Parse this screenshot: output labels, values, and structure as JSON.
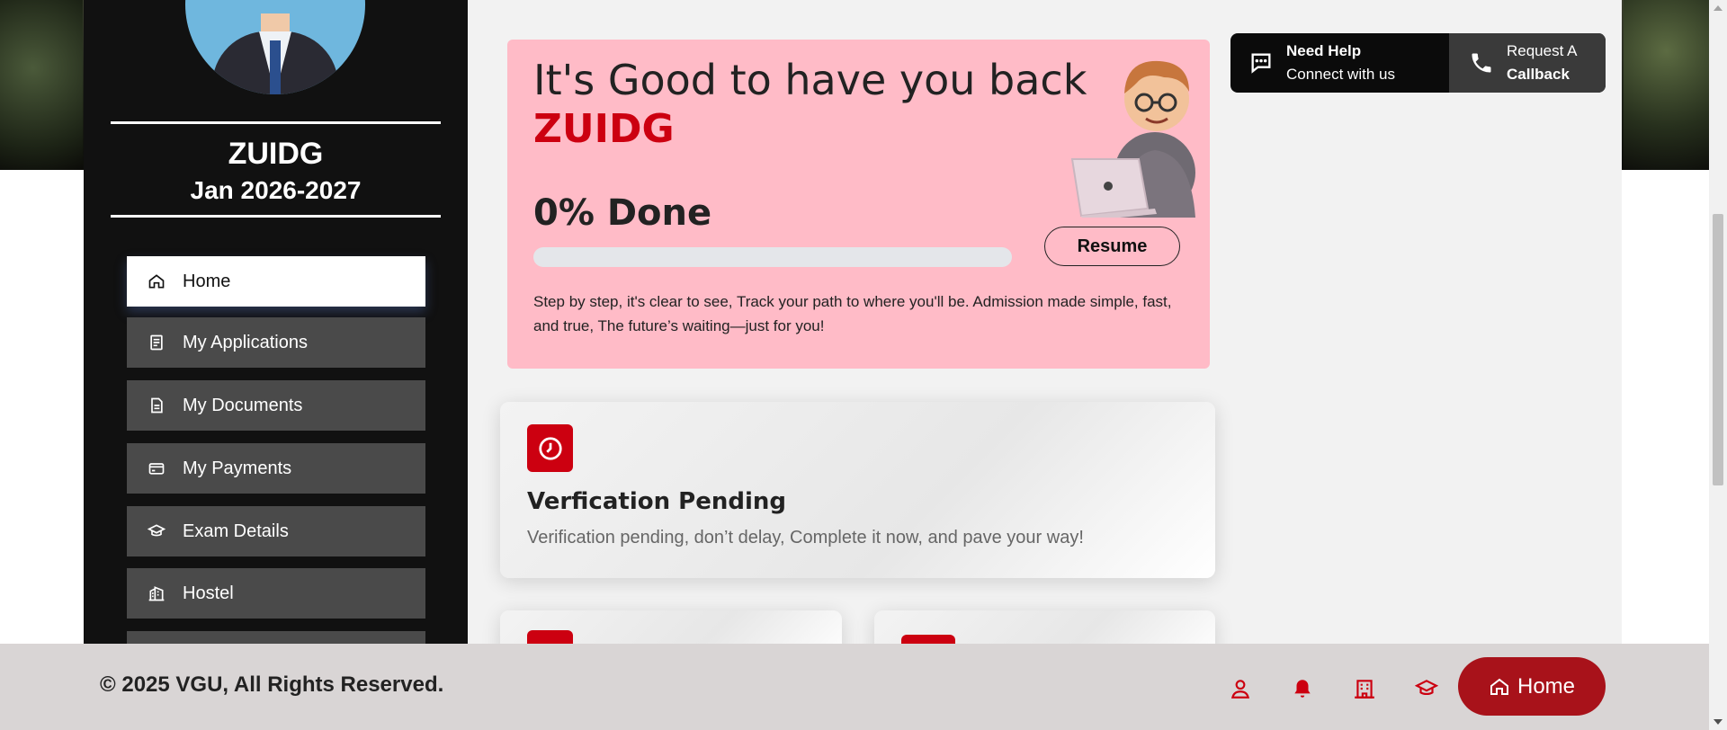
{
  "user": {
    "name": "ZUIDG",
    "session": "Jan 2026-2027"
  },
  "sidebar": {
    "items": [
      {
        "label": "Home",
        "icon": "home-icon"
      },
      {
        "label": "My Applications",
        "icon": "application-icon"
      },
      {
        "label": "My Documents",
        "icon": "document-icon"
      },
      {
        "label": "My Payments",
        "icon": "card-icon"
      },
      {
        "label": "Exam Details",
        "icon": "graduation-cap-icon"
      },
      {
        "label": "Hostel",
        "icon": "building-icon"
      }
    ]
  },
  "welcome": {
    "title": "It's Good to have you back",
    "name": "ZUIDG",
    "progress_label": "0% Done",
    "progress": 0,
    "resume_label": "Resume",
    "description": "Step by step, it's clear to see, Track your path to where you'll be. Admission made simple, fast, and true, The future’s waiting—just for you!"
  },
  "help": {
    "need_help": "Need Help",
    "connect": "Connect with us",
    "request": "Request A",
    "callback": "Callback"
  },
  "status_card": {
    "title": "Verfication Pending",
    "text": "Verification pending, don’t delay, Complete it now, and pave your way!"
  },
  "footer": {
    "copyright": "© 2025 VGU, All Rights Reserved.",
    "home_label": "Home"
  },
  "colors": {
    "accent": "#cc0010",
    "welcome_bg": "#ffbbc7",
    "sidebar_bg": "#111111",
    "footer_bg": "#d9d5d5",
    "home_button": "#a8121a"
  }
}
